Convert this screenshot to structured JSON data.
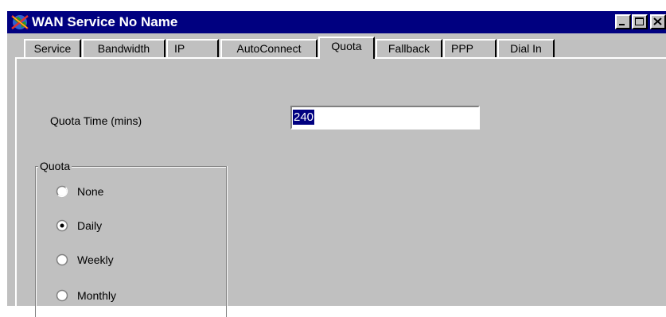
{
  "window": {
    "title": "WAN Service No Name"
  },
  "tabs": [
    {
      "label": "Service"
    },
    {
      "label": "Bandwidth"
    },
    {
      "label": "IP"
    },
    {
      "label": "AutoConnect"
    },
    {
      "label": "Quota",
      "active": true
    },
    {
      "label": "Fallback"
    },
    {
      "label": "PPP"
    },
    {
      "label": "Dial In"
    }
  ],
  "quota_time": {
    "label": "Quota Time (mins)",
    "value": "240"
  },
  "quota_group": {
    "legend": "Quota",
    "options": [
      {
        "label": "None",
        "selected": false
      },
      {
        "label": "Daily",
        "selected": true
      },
      {
        "label": "Weekly",
        "selected": false
      },
      {
        "label": "Monthly",
        "selected": false
      }
    ]
  },
  "colors": {
    "title_bar": "#000080",
    "face": "#c0c0c0",
    "selection": "#000080"
  }
}
